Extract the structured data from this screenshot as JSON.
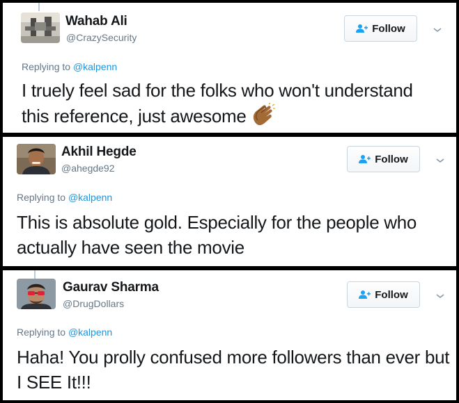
{
  "tweets": [
    {
      "name": "Wahab Ali",
      "handle": "@CrazySecurity",
      "follow_label": "Follow",
      "replying_prefix": "Replying to",
      "replying_to": "@kalpenn",
      "text": "I truely feel sad for the folks who won't understand this reference, just awesome",
      "emoji": "clapping-hands-icon"
    },
    {
      "name": "Akhil Hegde",
      "handle": "@ahegde92",
      "follow_label": "Follow",
      "replying_prefix": "Replying to",
      "replying_to": "@kalpenn",
      "text": "This is absolute gold. Especially for the people who actually have seen the movie"
    },
    {
      "name": "Gaurav Sharma",
      "handle": "@DrugDollars",
      "follow_label": "Follow",
      "replying_prefix": "Replying to",
      "replying_to": "@kalpenn",
      "text": "Haha! You prolly confused more followers than ever but I SEE It!!!"
    }
  ],
  "colors": {
    "mention": "#1b95e0",
    "follow_icon": "#1da1f2",
    "muted_text": "#657786"
  }
}
